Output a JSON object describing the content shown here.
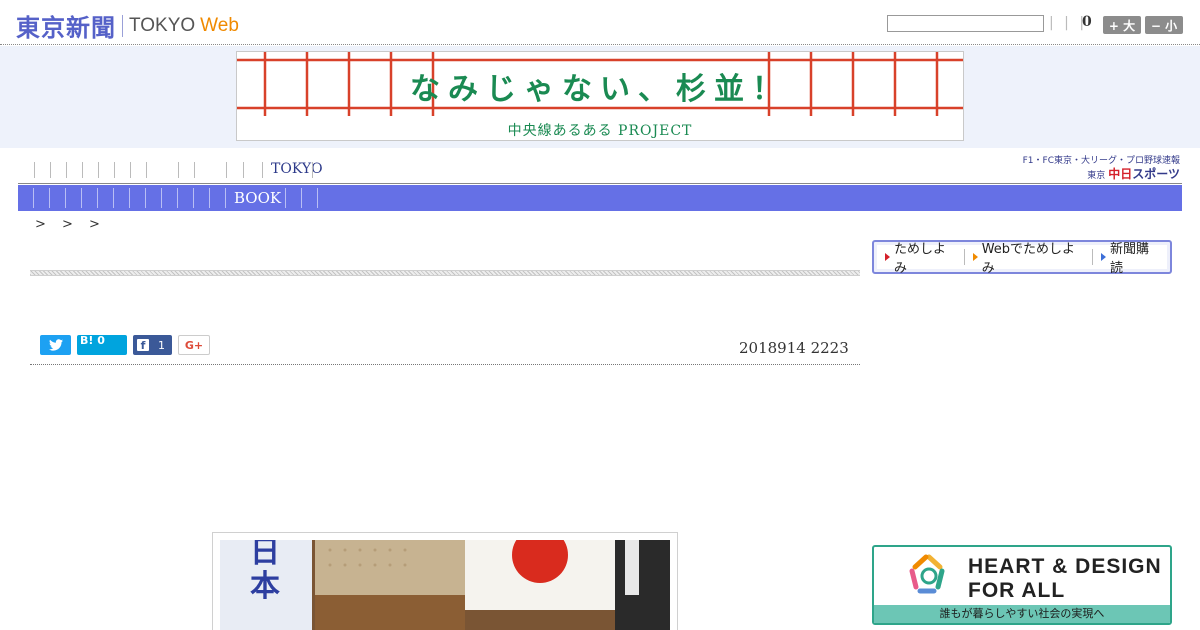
{
  "header": {
    "logo_kanji": "東京新聞",
    "logo_tokyo": "TOKYO",
    "logo_web": "Web",
    "util_links": "| | |",
    "util_count": "0",
    "font_larger_label": "+ 大",
    "font_smaller_label": "− 小"
  },
  "banner": {
    "title": "なみじゃない、杉並！",
    "subtitle": "中央線あるある PROJECT"
  },
  "nav": {
    "category_label": "TOKYO",
    "sub_label": "BOOK"
  },
  "chunichi": {
    "top": "F1・FC東京・大リーグ・プロ野球速報",
    "prefix": "東京",
    "name_a": "中日",
    "name_b": "スポーツ"
  },
  "breadcrumb": "> > >",
  "subscribe": {
    "item1": "ためしよみ",
    "item2": "Webでためしよみ",
    "item3": "新聞購読"
  },
  "share": {
    "hatena_label": "B!",
    "hatena_count": "0",
    "facebook_count": "1",
    "gplus_label": "G+"
  },
  "article": {
    "date": "2018914 2223"
  },
  "ad": {
    "line1": "HEART & DESIGN",
    "line2": "FOR ALL",
    "footer": "誰もが暮らしやすい社会の実現へ"
  },
  "colors": {
    "brand": "#5561c8",
    "subnav": "#6570e6",
    "banner_green": "#1a8a52",
    "web_orange": "#f08a00"
  }
}
